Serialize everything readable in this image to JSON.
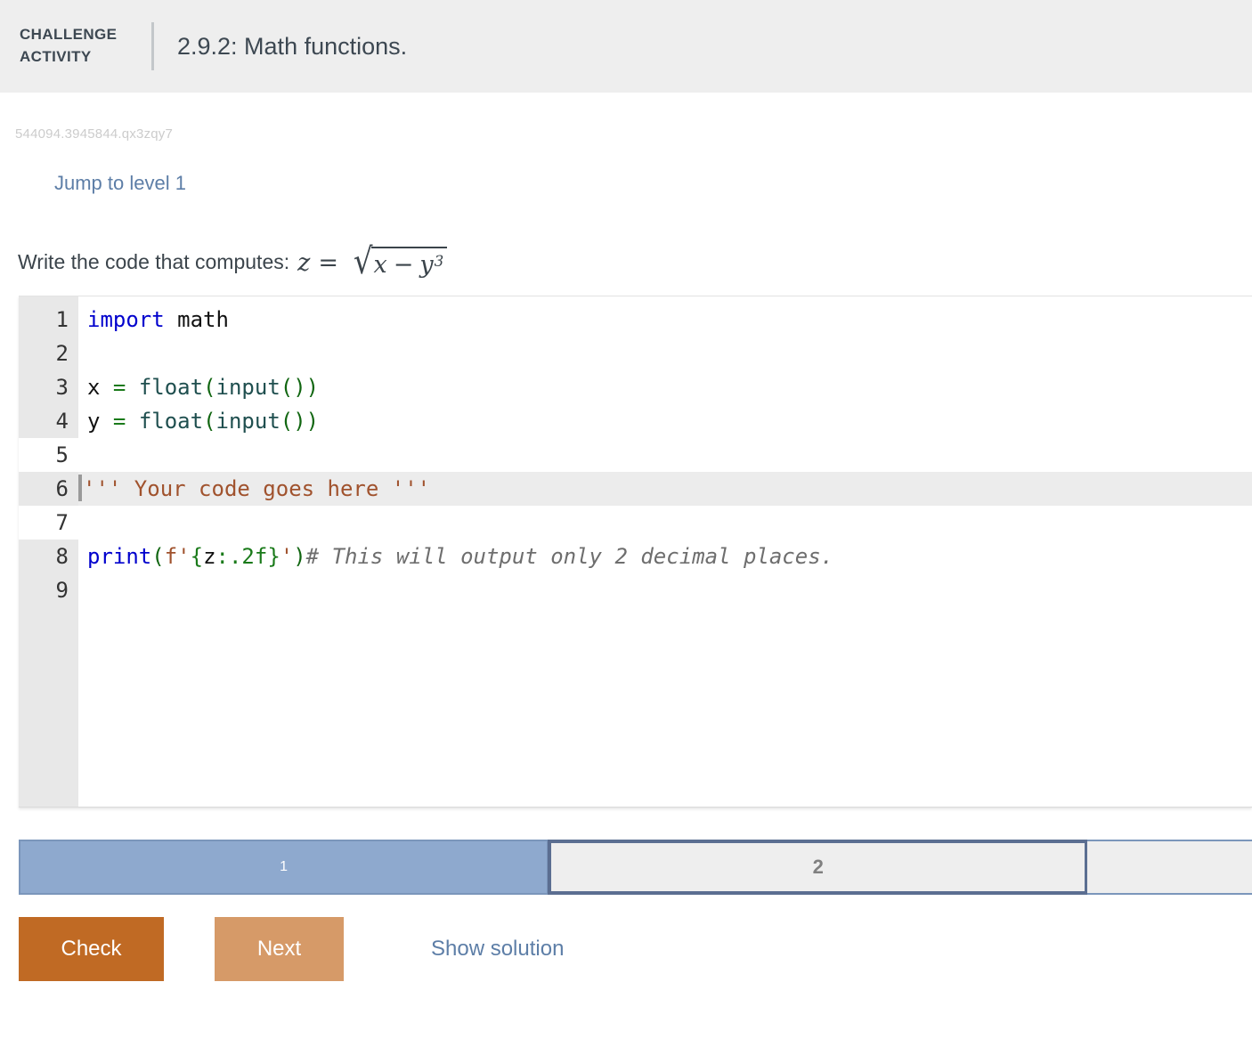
{
  "header": {
    "kicker_line1": "CHALLENGE",
    "kicker_line2": "ACTIVITY",
    "title": "2.9.2: Math functions."
  },
  "activity": {
    "id": "544094.3945844.qx3zqy7",
    "jump_link": "Jump to level 1",
    "prompt": "Write the code that computes:",
    "formula": {
      "lhs": "z",
      "equals": "=",
      "radical_sign": "√",
      "radicand_first": "x",
      "minus": "−",
      "radicand_second": "y",
      "exponent": "3",
      "plain_text": "z = sqrt(x - y^3)"
    }
  },
  "editor": {
    "line_numbers": [
      "1",
      "2",
      "3",
      "4",
      "5",
      "6",
      "7",
      "8",
      "9"
    ],
    "lines": [
      {
        "n": "1",
        "gutter_shaded": true,
        "highlight": false,
        "tokens": [
          {
            "t": "import",
            "c": "tok-kw"
          },
          {
            "t": " math",
            "c": "tok-plain"
          }
        ]
      },
      {
        "n": "2",
        "gutter_shaded": true,
        "highlight": false,
        "tokens": []
      },
      {
        "n": "3",
        "gutter_shaded": true,
        "highlight": false,
        "tokens": [
          {
            "t": "x ",
            "c": "tok-plain"
          },
          {
            "t": "=",
            "c": "tok-paren"
          },
          {
            "t": " ",
            "c": "tok-plain"
          },
          {
            "t": "float",
            "c": "tok-fn"
          },
          {
            "t": "(",
            "c": "tok-paren-d"
          },
          {
            "t": "input",
            "c": "tok-fn"
          },
          {
            "t": "()",
            "c": "tok-paren-d"
          },
          {
            "t": ")",
            "c": "tok-paren-d"
          }
        ]
      },
      {
        "n": "4",
        "gutter_shaded": true,
        "highlight": false,
        "tokens": [
          {
            "t": "y ",
            "c": "tok-plain"
          },
          {
            "t": "=",
            "c": "tok-paren"
          },
          {
            "t": " ",
            "c": "tok-plain"
          },
          {
            "t": "float",
            "c": "tok-fn"
          },
          {
            "t": "(",
            "c": "tok-paren-d"
          },
          {
            "t": "input",
            "c": "tok-fn"
          },
          {
            "t": "()",
            "c": "tok-paren-d"
          },
          {
            "t": ")",
            "c": "tok-paren-d"
          }
        ]
      },
      {
        "n": "5",
        "gutter_shaded": false,
        "highlight": false,
        "tokens": []
      },
      {
        "n": "6",
        "gutter_shaded": true,
        "highlight": true,
        "cursor": true,
        "tokens": [
          {
            "t": "''' Your code goes here '''",
            "c": "tok-str"
          }
        ]
      },
      {
        "n": "7",
        "gutter_shaded": false,
        "highlight": false,
        "tokens": []
      },
      {
        "n": "8",
        "gutter_shaded": true,
        "highlight": false,
        "tokens": [
          {
            "t": "print",
            "c": "tok-kw"
          },
          {
            "t": "(",
            "c": "tok-paren-d"
          },
          {
            "t": "f'",
            "c": "tok-str"
          },
          {
            "t": "{",
            "c": "tok-green"
          },
          {
            "t": "z",
            "c": "tok-plain"
          },
          {
            "t": ":.2f",
            "c": "tok-green"
          },
          {
            "t": "}",
            "c": "tok-green"
          },
          {
            "t": "'",
            "c": "tok-str"
          },
          {
            "t": ")",
            "c": "tok-paren-d"
          },
          {
            "t": "# This will output only 2 decimal places.",
            "c": "tok-comment"
          }
        ]
      },
      {
        "n": "9",
        "gutter_shaded": true,
        "highlight": false,
        "tokens": []
      }
    ],
    "full_text": "import math\n\nx = float(input())\ny = float(input())\n\n''' Your code goes here '''\n\nprint(f'{z:.2f}')# This will output only 2 decimal places.\n"
  },
  "progress": {
    "segments": [
      {
        "label": "1",
        "state": "completed"
      },
      {
        "label": "2",
        "state": "current"
      },
      {
        "label": "",
        "state": "upcoming"
      }
    ]
  },
  "actions": {
    "check_label": "Check",
    "next_label": "Next",
    "show_solution_label": "Show solution"
  },
  "colors": {
    "header_bg": "#eeeeee",
    "link": "#5d7ea7",
    "check_button": "#c06a24",
    "next_button": "#d69a68",
    "progress_done": "#8ea9ce",
    "progress_current_border": "#5b6e91",
    "gutter_bg": "#e8e8e8",
    "line_highlight": "#ececec"
  }
}
